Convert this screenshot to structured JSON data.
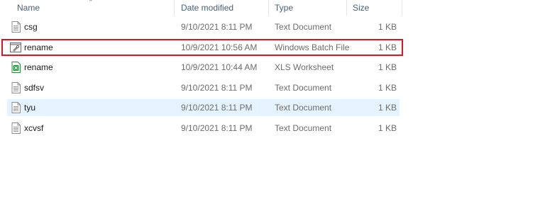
{
  "columns": {
    "name": "Name",
    "date_modified": "Date modified",
    "type": "Type",
    "size": "Size"
  },
  "files": [
    {
      "name": "csg",
      "date": "9/10/2021 8:11 PM",
      "type": "Text Document",
      "size": "1 KB",
      "icon": "text-document-icon"
    },
    {
      "name": "rename",
      "date": "10/9/2021 10:56 AM",
      "type": "Windows Batch File",
      "size": "1 KB",
      "icon": "batch-file-icon",
      "highlighted": true
    },
    {
      "name": "rename",
      "date": "10/9/2021 10:44 AM",
      "type": "XLS Worksheet",
      "size": "1 KB",
      "icon": "xls-worksheet-icon"
    },
    {
      "name": "sdfsv",
      "date": "9/10/2021 8:11 PM",
      "type": "Text Document",
      "size": "1 KB",
      "icon": "text-document-icon"
    },
    {
      "name": "tyu",
      "date": "9/10/2021 8:11 PM",
      "type": "Text Document",
      "size": "1 KB",
      "icon": "text-document-icon",
      "hovered": true
    },
    {
      "name": "xcvsf",
      "date": "9/10/2021 8:11 PM",
      "type": "Text Document",
      "size": "1 KB",
      "icon": "text-document-icon"
    }
  ],
  "colors": {
    "highlight_border": "#e0141e",
    "hover_background": "#e5f3ff",
    "header_text": "#4c607a"
  }
}
